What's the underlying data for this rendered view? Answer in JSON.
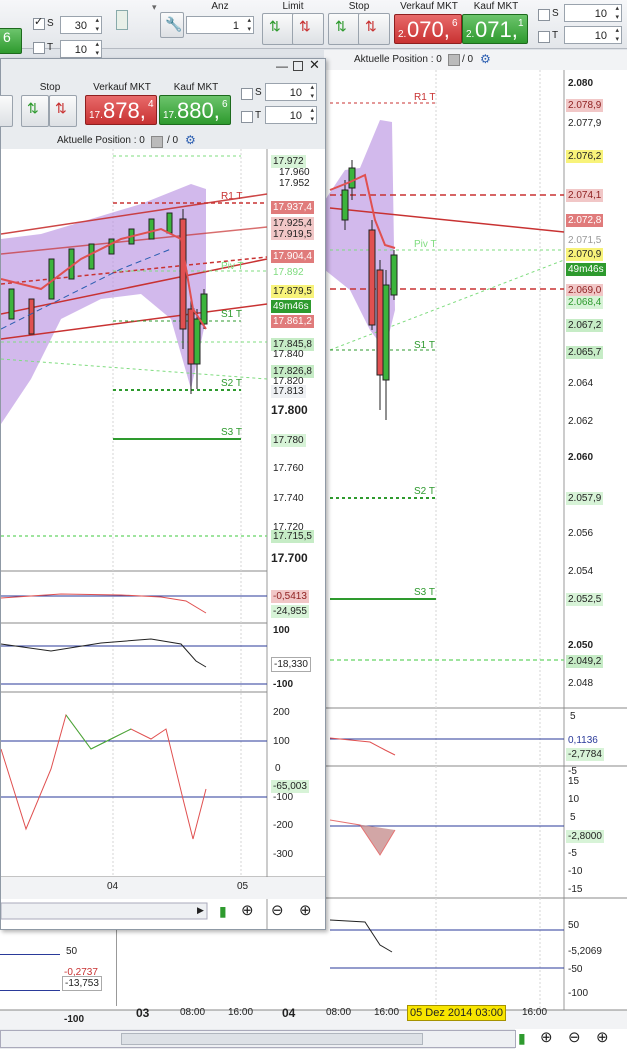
{
  "toolbar": {
    "anz_label": "Anz",
    "anz_value": "1",
    "limit_label": "Limit",
    "stop_label": "Stop",
    "sell_label": "Verkauf MKT",
    "buy_label": "Kauf MKT",
    "sell_small": "2.",
    "sell_big": "070,",
    "sell_sup": "6",
    "buy_small": "2.",
    "buy_big": "071,",
    "buy_sup": "1",
    "s_label": "S",
    "s_value": "10",
    "t_label": "T",
    "t_value": "10",
    "left_s_label": "S",
    "left_s_value": "30",
    "left_t_label": "T",
    "left_t_value": "10",
    "left_price_sup": "6",
    "position_label": "Aktuelle Position : 0",
    "position_sep": "/ 0"
  },
  "win": {
    "stop_label": "Stop",
    "sell_label": "Verkauf MKT",
    "buy_label": "Kauf MKT",
    "sell_small": "17.",
    "sell_big": "878,",
    "sell_sup": "4",
    "buy_small": "17.",
    "buy_big": "880,",
    "buy_sup": "6",
    "s_label": "S",
    "s_value": "10",
    "t_label": "T",
    "t_value": "10",
    "position_label": "Aktuelle Position : 0",
    "position_sep": "/ 0",
    "axis": [
      "17.960",
      "17.952",
      "17.800",
      "17.760",
      "17.740",
      "17.720",
      "17.700"
    ],
    "tags": {
      "t1": "17.972",
      "t2": "17.937,4",
      "t3": "17.925,4",
      "t4": "17.919,5",
      "t5": "17.904,4",
      "t6": "17.892",
      "t7": "17.879,5",
      "t8": "49m46s",
      "t9": "17.861,2",
      "t10": "17.845,8",
      "t11": "17.840",
      "t12": "17.826,8",
      "t13": "17.820",
      "t14": "17.813",
      "t15": "17.780",
      "t16": "17.715,5"
    },
    "lines": {
      "r1": "R1 T",
      "piv": "Piv T",
      "s1": "S1 T",
      "s2": "S2 T",
      "s3": "S3 T"
    },
    "ind1": {
      "v1": "-0,5413",
      "v2": "-24,955"
    },
    "ind2": {
      "top": "100",
      "v": "-18,330",
      "bottom": "-100"
    },
    "ind3": {
      "a": "200",
      "b": "100",
      "c": "0",
      "v": "-65,003",
      "d": "-100",
      "e": "-200",
      "f": "-300"
    },
    "xaxis": {
      "a": "04",
      "b": "05"
    }
  },
  "main": {
    "axis": [
      "2.080",
      "2.077,9",
      "2.064",
      "2.062",
      "2.060",
      "2.056",
      "2.054",
      "2.050",
      "2.048"
    ],
    "tags": {
      "a": "2.078,9",
      "b": "2.076,2",
      "c": "2.074,1",
      "d": "2.072,8",
      "e": "2.071,5",
      "f": "2.070,9",
      "g": "49m46s",
      "h": "2.069,0",
      "i": "2.068,4",
      "j": "2.067,2",
      "k": "2.065,7",
      "l": "2.057,9",
      "m": "2.052,5",
      "n": "2.049,2"
    },
    "lines": {
      "r1": "R1 T",
      "piv": "Piv T",
      "s1": "S1 T",
      "s2": "S2 T",
      "s3": "S3 T"
    },
    "ind1": {
      "a": "5",
      "b": "0,1136",
      "c": "-2,7784",
      "d": "-5"
    },
    "ind2": {
      "a": "15",
      "b": "10",
      "c": "5",
      "v": "-2,8000",
      "d": "-5",
      "e": "-10",
      "f": "-15"
    },
    "ind3": {
      "a": "50",
      "v": "-5,2069",
      "b": "-50",
      "c": "-100"
    },
    "xaxis": {
      "a": "03",
      "b": "08:00",
      "c": "16:00",
      "d": "04",
      "e": "08:00",
      "f": "16:00",
      "cursor": "05 Dez 2014 03:00"
    },
    "left_ind": {
      "a": "50",
      "v1": "-0,2737",
      "v2": "-13,753",
      "b": "-100"
    }
  },
  "colors": {
    "red": "#c83232",
    "green": "#2e9a2e",
    "purple": "#b48be0"
  }
}
